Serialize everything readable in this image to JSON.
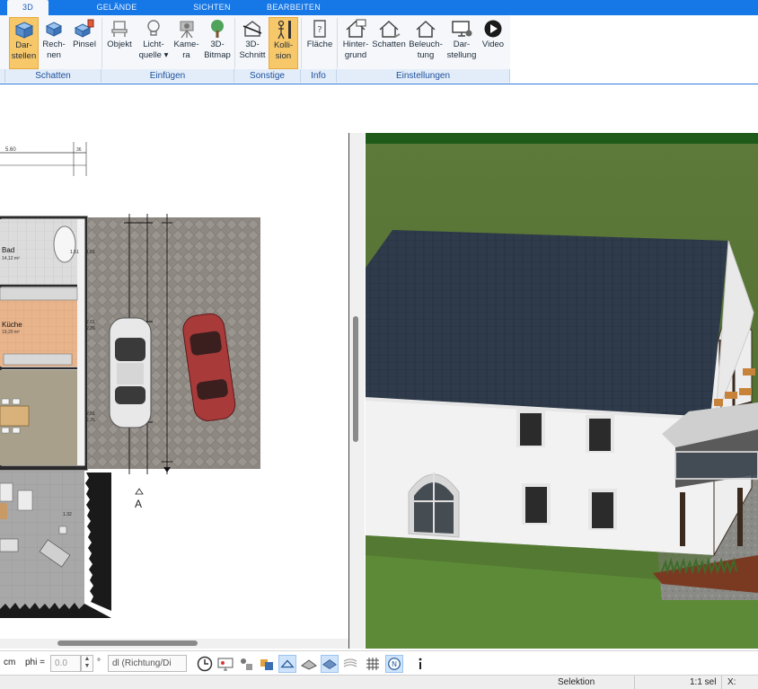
{
  "tabs": [
    {
      "label": "3D",
      "active": true
    },
    {
      "label": "GELÄNDE"
    },
    {
      "label": "SICHTEN"
    },
    {
      "label": "BEARBEITEN"
    }
  ],
  "ribbon": {
    "buttons": [
      {
        "label": "Dar-\nstellen",
        "icon": "cube-display-icon",
        "active": true
      },
      {
        "label": "Rech-\nnen",
        "icon": "cube-compute-icon"
      },
      {
        "label": "Pinsel",
        "icon": "paint-cube-icon"
      },
      {
        "label": "Objekt",
        "icon": "chair-icon"
      },
      {
        "label": "Licht-\nquelle ▾",
        "icon": "lightbulb-icon"
      },
      {
        "label": "Kame-\nra",
        "icon": "camera-icon"
      },
      {
        "label": "3D-\nBitmap",
        "icon": "tree-icon"
      },
      {
        "label": "3D-\nSchnitt",
        "icon": "cut-icon"
      },
      {
        "label": "Kolli-\nsion",
        "icon": "person-wall-icon",
        "active": true
      },
      {
        "label": "Fläche",
        "icon": "area-icon"
      },
      {
        "label": "Hinter-\ngrund",
        "icon": "house-background-icon"
      },
      {
        "label": "Schatten",
        "icon": "house-shadow-icon"
      },
      {
        "label": "Beleuch-\ntung",
        "icon": "house-light-icon"
      },
      {
        "label": "Dar-\nstellung",
        "icon": "monitor-settings-icon"
      },
      {
        "label": "Video",
        "icon": "play-icon"
      }
    ],
    "groups": [
      {
        "label": "Schatten"
      },
      {
        "label": "Einfügen"
      },
      {
        "label": "Sonstige"
      },
      {
        "label": "Info"
      },
      {
        "label": "Einstellungen"
      }
    ]
  },
  "plan": {
    "dimension_top": "5.60",
    "dimension_top_small": "36",
    "rooms": [
      {
        "name": "Bad",
        "area": "14,12 m²"
      },
      {
        "name": "Küche",
        "area": "19,20 m²"
      }
    ],
    "dimensions": [
      "1.51",
      "1.01",
      "2.01",
      "2.26",
      "2.01",
      "2.26",
      "1.32"
    ],
    "section_marker": "A"
  },
  "bottom": {
    "unit": "cm",
    "phi_label": "phi =",
    "phi_value": "0.0",
    "degree": "°",
    "dl_label": "dl (Richtung/Di"
  },
  "status": {
    "mode": "Selektion",
    "scale": "1:1 sel",
    "coord_label": "X:"
  },
  "colors": {
    "tab_bar": "#1677e6",
    "accent_active": "#f7c86a",
    "group_label": "#1c4f9c"
  }
}
